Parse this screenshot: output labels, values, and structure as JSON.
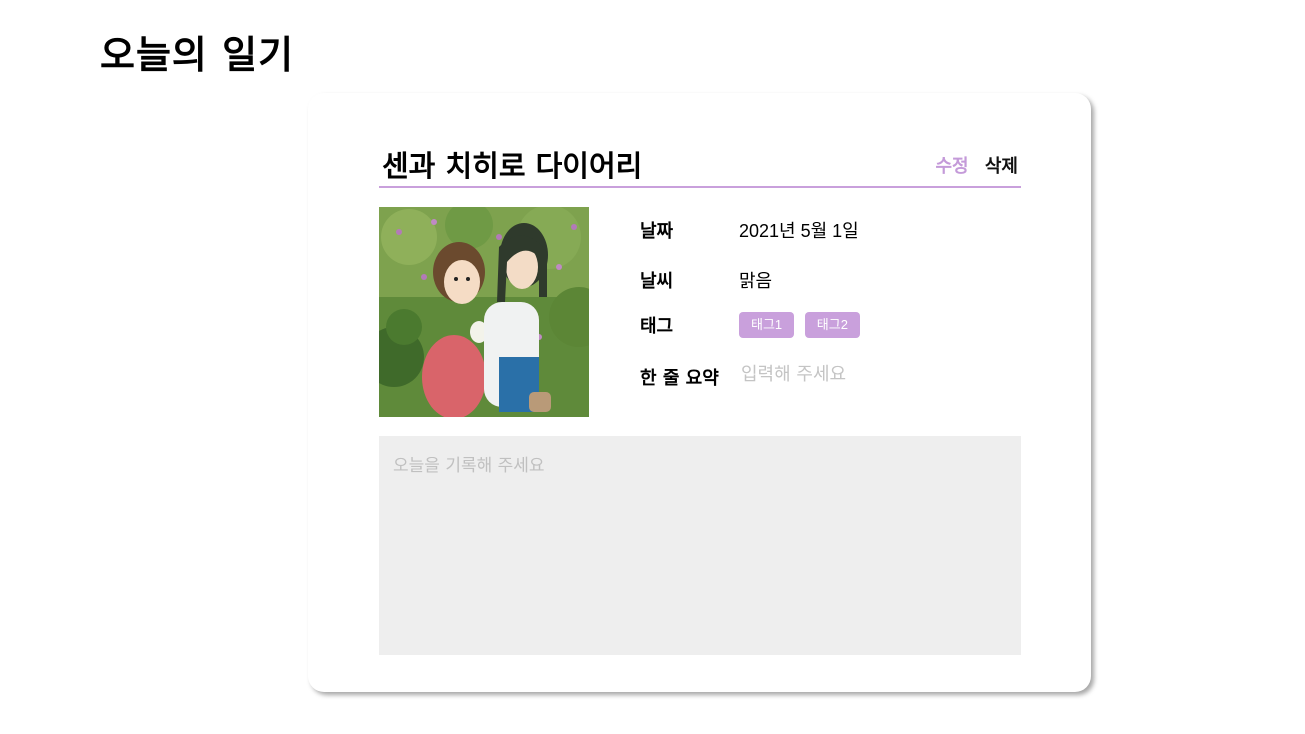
{
  "page": {
    "title": "오늘의 일기"
  },
  "diary": {
    "title": "센과 치히로 다이어리",
    "actions": {
      "edit": "수정",
      "delete": "삭제"
    },
    "image_alt": "spirited-away-illustration",
    "fields": {
      "date_label": "날짜",
      "date_value": "2021년 5월 1일",
      "weather_label": "날씨",
      "weather_value": "맑음",
      "tags_label": "태그",
      "tags": [
        "태그1",
        "태그2"
      ],
      "summary_label": "한 줄 요약",
      "summary_placeholder": "입력해 주세요",
      "summary_value": ""
    },
    "body_placeholder": "오늘을 기록해 주세요",
    "body_value": ""
  },
  "colors": {
    "accent": "#c9a0dc",
    "edit_link": "#c49ad9",
    "textarea_bg": "#eeeeee"
  }
}
